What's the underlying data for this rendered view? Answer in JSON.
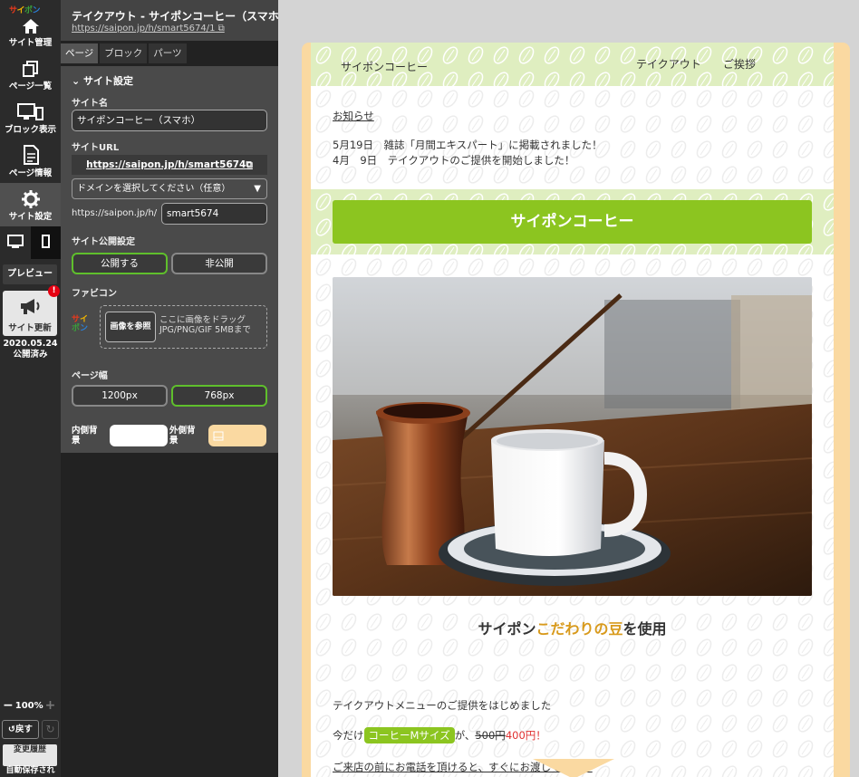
{
  "app": {
    "logo": [
      "サ",
      "イ",
      "ポ",
      "ン"
    ],
    "logo_colors": [
      "#e8391d",
      "#f0b400",
      "#3aa13a",
      "#2b7fd6"
    ]
  },
  "rail": {
    "items": [
      {
        "label": "サイト管理",
        "icon": "home-icon"
      },
      {
        "label": "ページ一覧",
        "icon": "pages-icon"
      },
      {
        "label": "ブロック表示",
        "icon": "monitor-icon"
      },
      {
        "label": "ページ情報",
        "icon": "document-icon"
      },
      {
        "label": "サイト設定",
        "icon": "gear-icon"
      }
    ],
    "preview_label": "プレビュー",
    "update_label": "サイト更新",
    "update_badge": "!",
    "publish_date": "2020.05.24",
    "publish_status": "公開済み",
    "zoom_minus": "−",
    "zoom_level": "100%",
    "zoom_plus": "+",
    "undo_label": "戻す",
    "history_label": "変更履歴",
    "history_sub": "自動保存",
    "autosave_label": "自動保存され"
  },
  "panel": {
    "title": "テイクアウト - サイポンコーヒー（スマホ）",
    "url": "https://saipon.jp/h/smart5674/1",
    "tabs": [
      "ページ",
      "ブロック",
      "パーツ"
    ],
    "section_title": "サイト設定",
    "site_name_label": "サイト名",
    "site_name_value": "サイポンコーヒー（スマホ）",
    "site_url_label": "サイトURL",
    "site_url_value": "https://saipon.jp/h/smart5674",
    "domain_select": "ドメインを選択してください（任意）",
    "url_prefix": "https://saipon.jp/h/",
    "url_slug": "smart5674",
    "publish_label": "サイト公開設定",
    "publish_on": "公開する",
    "publish_off": "非公開",
    "favicon_label": "ファビコン",
    "favicon_button": "画像を参照",
    "favicon_hint_1": "ここに画像をドラッグ",
    "favicon_hint_2": "JPG/PNG/GIF 5MBまで",
    "width_label": "ページ幅",
    "width_1200": "1200px",
    "width_768": "768px",
    "inner_bg_label_1": "内側背",
    "inner_bg_label_2": "景",
    "outer_bg_label_1": "外側背",
    "outer_bg_label_2": "景",
    "inner_bg_color": "#ffffff",
    "outer_bg_color": "#fad9a1",
    "accent_color": "#5fbf2c"
  },
  "site": {
    "brand": "サイポンコーヒー",
    "nav": [
      "テイクアウト",
      "ご挨拶"
    ],
    "news_heading": "お知らせ",
    "news": [
      "5月19日　雑誌「月間エキスパート」に掲載されました！",
      "4月　9日　テイクアウトのご提供を開始しました！"
    ],
    "hero_title": "サイポンコーヒー",
    "heading_pre": "サイポン",
    "heading_highlight": "こだわりの豆",
    "heading_post": "を使用",
    "intro": "テイクアウトメニューのご提供をはじめました",
    "offer_pre": "今だけ",
    "offer_tag": "コーヒーMサイズ",
    "offer_mid": "が、",
    "price_old": "500円",
    "price_new": "400円！",
    "notice": "ご来店の前にお電話を頂けると、すぐにお渡しできます",
    "green_color": "#8cc520",
    "highlight_color": "#d89a1c"
  }
}
